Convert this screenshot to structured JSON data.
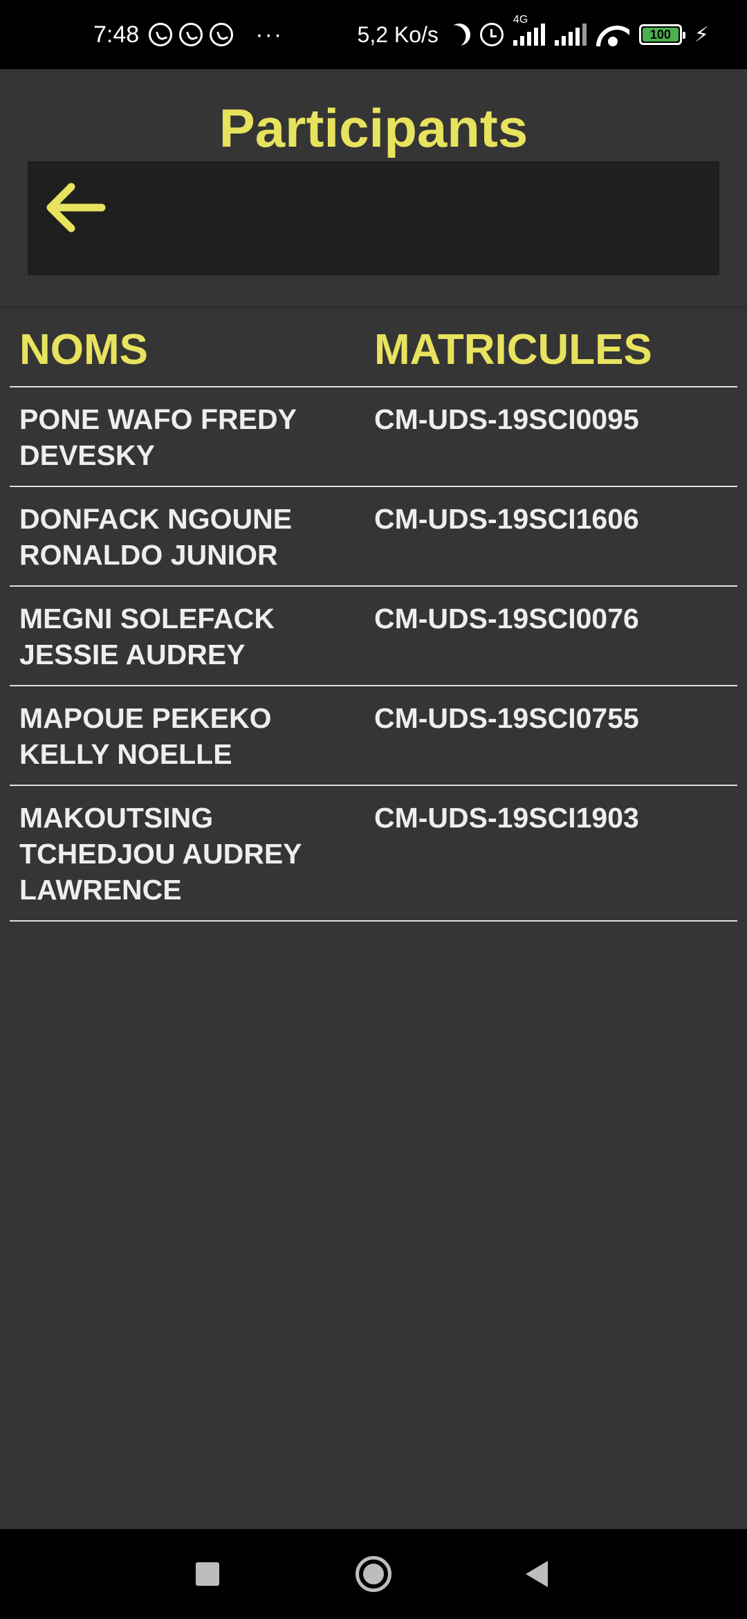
{
  "status_bar": {
    "time": "7:48",
    "network_speed": "5,2 Ko/s",
    "network_type": "4G",
    "battery": "100",
    "icons": [
      "whatsapp-icon",
      "whatsapp-icon",
      "whatsapp-icon",
      "more-dots-icon",
      "moon-icon",
      "alarm-icon",
      "signal-icon",
      "signal-icon",
      "wifi-icon",
      "battery-icon",
      "charging-icon"
    ]
  },
  "page": {
    "title": "Participants",
    "back_icon": "arrow-left-icon",
    "accent_color": "#e8e35e",
    "background_color": "#353535",
    "toolbar_color": "#1f1f1f"
  },
  "table": {
    "headers": [
      "NOMS",
      "MATRICULES"
    ],
    "rows": [
      {
        "name": "PONE WAFO FREDY DEVESKY",
        "matricule": "CM-UDS-19SCI0095"
      },
      {
        "name": "DONFACK NGOUNE RONALDO JUNIOR",
        "matricule": "CM-UDS-19SCI1606"
      },
      {
        "name": "MEGNI SOLEFACK JESSIE AUDREY",
        "matricule": "CM-UDS-19SCI0076"
      },
      {
        "name": "MAPOUE PEKEKO KELLY NOELLE",
        "matricule": "CM-UDS-19SCI0755"
      },
      {
        "name": "MAKOUTSING TCHEDJOU AUDREY LAWRENCE",
        "matricule": "CM-UDS-19SCI1903"
      }
    ]
  },
  "nav_bar": {
    "buttons": [
      "recents-square-icon",
      "home-circle-icon",
      "back-triangle-icon"
    ]
  }
}
